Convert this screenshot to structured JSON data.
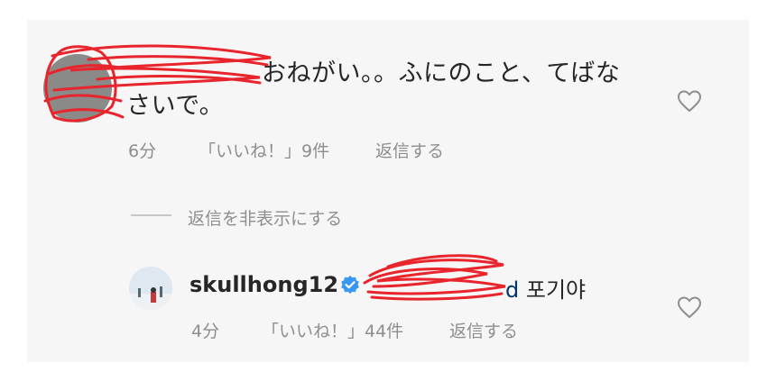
{
  "comment1": {
    "text_line1": "おねがい。。ふにのこと、てばな",
    "text_line2": "さいで。",
    "time": "6分",
    "likes": "「いいね！」9件",
    "reply": "返信する"
  },
  "hide_replies": "返信を非表示にする",
  "comment2": {
    "username": "skullhong12",
    "mention_tail": "d",
    "text": "포기야",
    "time": "4分",
    "likes": "「いいね！」44件",
    "reply": "返信する"
  },
  "colors": {
    "redaction": "#e8242c",
    "verified": "#3897f0",
    "meta": "#8e8e8e"
  }
}
